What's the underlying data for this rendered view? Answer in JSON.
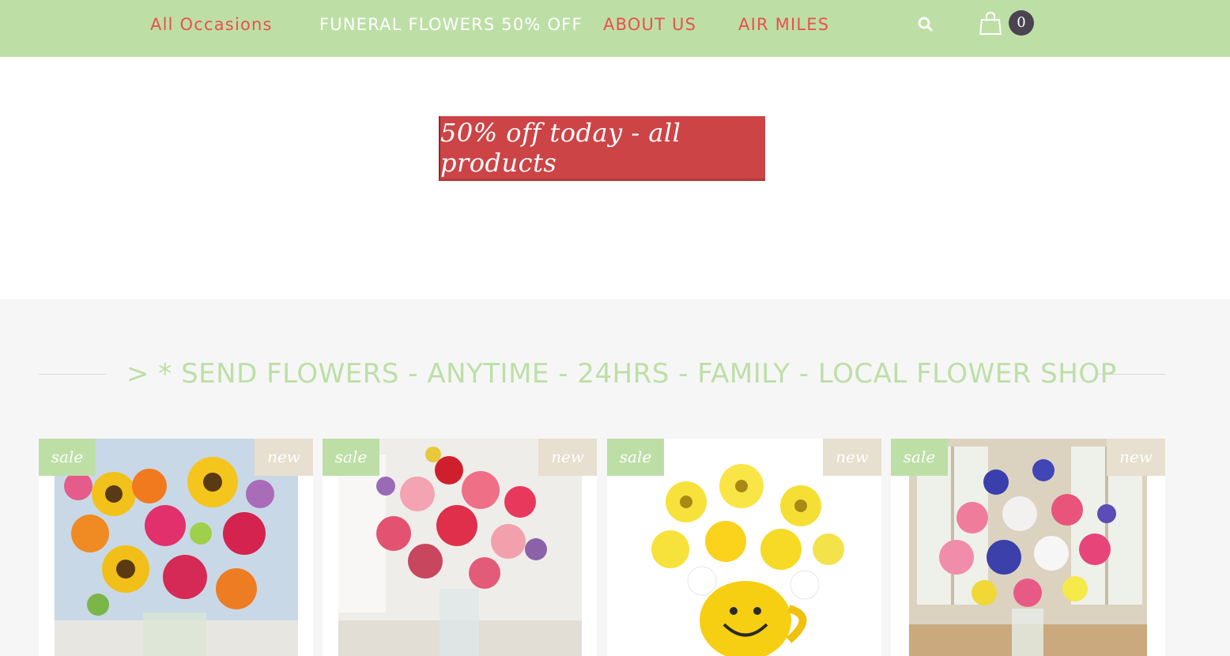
{
  "nav": {
    "items": [
      {
        "label": "All Occasions"
      },
      {
        "label": "FUNERAL FLOWERS 50% OFF"
      },
      {
        "label": "ABOUT US"
      },
      {
        "label": "AIR MILES"
      }
    ],
    "cart_count": "0",
    "icons": {
      "search": "search-icon",
      "cart": "shopping-bag-icon"
    }
  },
  "banner": {
    "text": "50% off today - all products"
  },
  "section": {
    "title": "> * SEND FLOWERS - ANYTIME - 24HRS - FAMILY - LOCAL FLOWER SHOP"
  },
  "products": [
    {
      "sale_badge": "sale",
      "new_badge": "new"
    },
    {
      "sale_badge": "sale",
      "new_badge": "new"
    },
    {
      "sale_badge": "sale",
      "new_badge": "new"
    },
    {
      "sale_badge": "sale",
      "new_badge": "new"
    }
  ],
  "colors": {
    "header_bg": "#bddfa6",
    "nav_red": "#ea4f52",
    "banner_red": "#cc4446",
    "section_bg": "#f6f6f6",
    "badge_sale": "#bddfa6",
    "badge_new": "#e7dfcf"
  }
}
